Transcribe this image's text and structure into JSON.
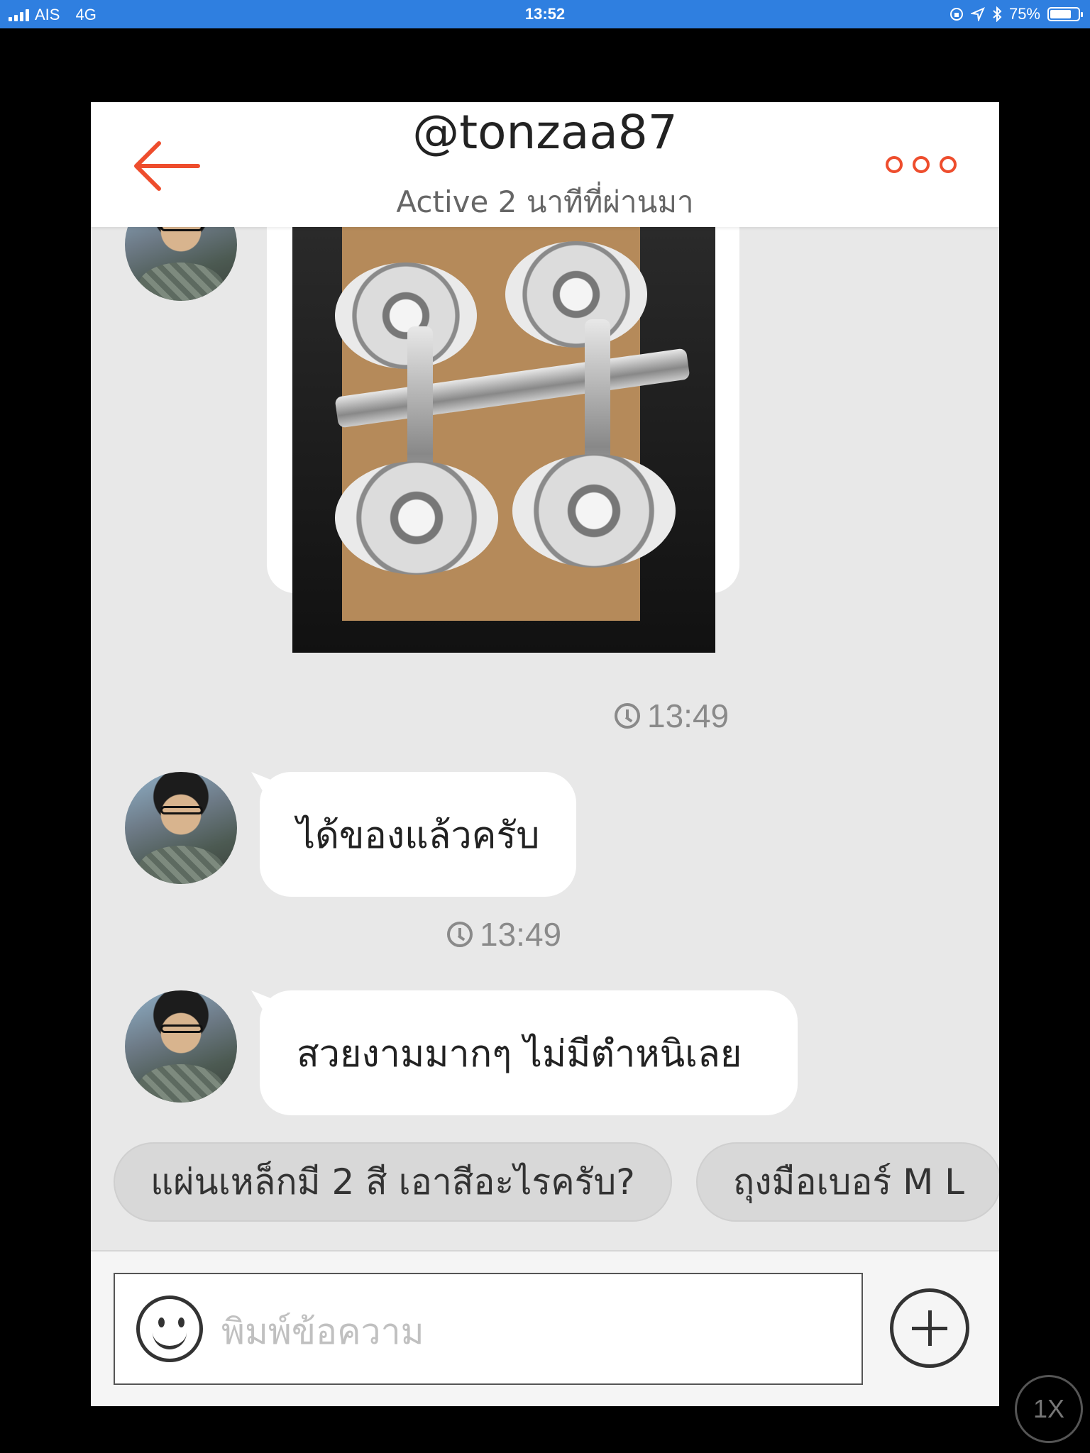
{
  "status_bar": {
    "carrier": "AIS",
    "network": "4G",
    "time": "13:52",
    "battery": "75%",
    "battery_level": 0.75
  },
  "header": {
    "username": "@tonzaa87",
    "status": "Active 2 นาทีที่ผ่านมา"
  },
  "messages": [
    {
      "type": "image",
      "time": "13:49",
      "image_alt": "dumbbell set on cardboard"
    },
    {
      "type": "text",
      "text": "ได้ของแล้วครับ",
      "time": "13:49"
    },
    {
      "type": "text",
      "text": "สวยงามมากๆ ไม่มีตำหนิเลย"
    }
  ],
  "quick_replies": [
    "แผ่นเหล็กมี 2 สี เอาสีอะไรครับ?",
    "ถุงมือเบอร์ M L"
  ],
  "composer": {
    "placeholder": "พิมพ์ข้อความ"
  },
  "playback": {
    "speed": "1X"
  },
  "colors": {
    "accent": "#ee4d2d",
    "status_bar": "#2f7fe0",
    "chat_bg": "#e8e8e8"
  }
}
